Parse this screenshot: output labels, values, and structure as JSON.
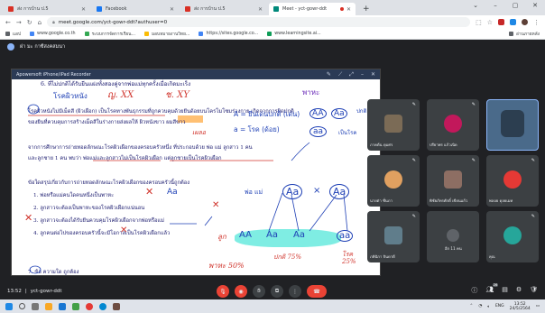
{
  "browser": {
    "tabs": [
      {
        "title": "ส่ง การบ้าน ป.5",
        "color": "#d93025",
        "active": false
      },
      {
        "title": "Facebook",
        "color": "#1877f2",
        "active": false
      },
      {
        "title": "ส่ง การบ้าน ป.5",
        "color": "#d93025",
        "active": false
      },
      {
        "title": "Meet - yct-gowr-ddt",
        "color": "#00897b",
        "active": true
      }
    ],
    "new_tab": "+",
    "url": "meet.google.com/yct-gowr-ddt?authuser=0",
    "bookmarks": [
      {
        "label": "แอป",
        "color": "#5f6368"
      },
      {
        "label": "www.google.co.th",
        "color": "#4285f4"
      },
      {
        "label": "ระบบการจัดการเรียน...",
        "color": "#34a853"
      },
      {
        "label": "มอบหมายงานวิทย...",
        "color": "#fbbc04"
      },
      {
        "label": "https://sites.google.co...",
        "color": "#4285f4"
      },
      {
        "label": "www.learningsite.ai...",
        "color": "#0f9d58"
      }
    ],
    "reading_list": "อ่านภายหลัง"
  },
  "meet": {
    "presenter": "ฝา มะ กาซีสงคสมนา",
    "recorder_title": "Apowersoft iPhone/iPad Recorder",
    "time": "13:52",
    "code": "yct-gowr-ddt",
    "participants_count": "26",
    "tiles": [
      {
        "name": "ภาคต้น ดุมศร",
        "avatar_color": "#7b6b56"
      },
      {
        "name": "ปรียาพร แก้วเนิด",
        "avatar_color": "#c2185b"
      },
      {
        "name": "",
        "avatar_color": "#5a7fa8"
      },
      {
        "name": "นายต่า ชื่นภา",
        "avatar_color": "#e0a060"
      },
      {
        "name": "พิชัยภัทรศักดิ์ เขียนแก้ว",
        "avatar_color": "#8d6e63"
      },
      {
        "name": "พลอย ดุลยเมท",
        "avatar_color": "#e53935"
      },
      {
        "name": "ภคินิกา จินดาดี",
        "avatar_color": "#607d8b"
      },
      {
        "name": "อีก 11 คน",
        "avatar_color": "#5f6368"
      },
      {
        "name": "คุณ",
        "avatar_color": "#26a69a"
      }
    ]
  },
  "document": {
    "lines": [
      "6. ที่ไม่ปกติได้รับยีนแฝงทั้งสองคู่จากพ่อแม่ทุกครั้งเมื่อเกิดมะเร็ง",
      "โรคผิวหนังไม่มีเม็ดสี (ผิวเผือก) เป็นโรคทางพันธุกรรมที่ถูกควบคุมด้วยยีนด้อยบนโครโมโซมร่างกาย เกิดจากการผิดปกติ",
      "ของยีนที่ควบคุมการสร้างเม็ดสีในร่างกายส่งผลให้ ผิวหนังขาว ผมสีขาว",
      "จากการศึกษาการถ่ายทอดลักษณะโรคผิวเผือกของครอบครัวหนึ่ง ที่ประกอบด้วย พ่อ แม่ ลูกสาว 1 คน",
      "และลูกชาย 1 คน พบว่า พ่อแม่และลูกสาวไม่เป็นโรคผิวเผือก แต่ลูกชายเป็นโรคผิวเผือก",
      "ข้อใดสรุปเกี่ยวกับการถ่ายทอดลักษณะโรคผิวเผือกของครอบครัวนี้ถูกต้อง",
      "1. พ่อหรือแม่คนใดคนหนึ่งเป็นพาหะ",
      "2. ลูกสาวจะต้องเป็นพาหะของโรคผิวเผือกแน่นอน",
      "3. ลูกสาวจะต้องได้รับยีนควบคุมโรคผิวเผือกจากพ่อหรือแม่",
      "4. ลูกคนต่อไปของครอบครัวนี้จะมีโอกาสเป็นโรคผิวเผือกแล้ว",
      "7. ข้อ ความใด ถูกต้อง"
    ],
    "annotations": {
      "title_note": "โรคผิวหนัง",
      "xx": "ญ. XX",
      "xy": "ช. XY",
      "carrier_top": "พาหะ",
      "recessive_note": "เผลอ",
      "allele_A": "A = ยีนเด่นปกติ (เด่น)",
      "allele_a": "a = โรค (ด้อย)",
      "geno_AA": "AA",
      "geno_Aa": "Aa",
      "normal": "ปกติ",
      "geno_aa": "aa",
      "albino": "เป็นโรค",
      "father_label": "พ่อ แม่",
      "cross_Aa1": "Aa",
      "cross_x": "×",
      "cross_Aa2": "Aa",
      "offspring_label": "ลูก",
      "off_AA": "AA",
      "off_Aa1": "Aa",
      "off_Aa2": "Aa",
      "off_aa": "aa",
      "normal_pct": "ปกติ 75%",
      "sick_pct": "โรค 25%",
      "carrier_pct": "พาหะ 50%",
      "mark_x": "✕"
    }
  },
  "taskbar": {
    "time": "13:52",
    "date": "24/5/2564",
    "lang": "ENG"
  },
  "colors": {
    "meet_bg": "#202124",
    "end_call": "#ea4335",
    "ink_red": "#d0342c",
    "ink_blue": "#1d3fb5",
    "highlight_green": "#00dcc8"
  }
}
